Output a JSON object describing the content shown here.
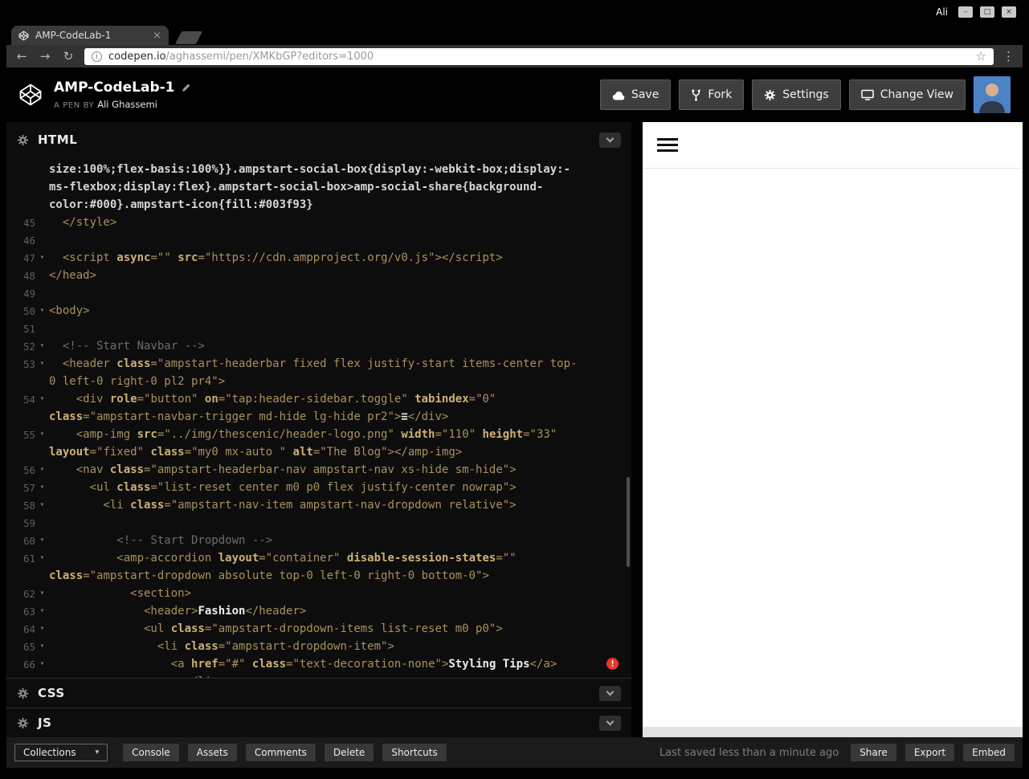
{
  "window": {
    "user": "Ali"
  },
  "icons": {
    "minimize": "–",
    "maximize": "□",
    "close": "×",
    "back": "←",
    "forward": "→",
    "reload": "↻",
    "info": "i",
    "star": "☆",
    "menu_dots": "⋮",
    "dropdown_caret": "▾",
    "fold": "▾",
    "error": "!"
  },
  "browser": {
    "tab_title": "AMP-CodeLab-1",
    "url_domain": "codepen.io",
    "url_path": "/aghassemi/pen/XMKbGP?editors=1000"
  },
  "header": {
    "pen_title": "AMP-CodeLab-1",
    "byline_prefix": "A PEN BY",
    "author": "Ali Ghassemi",
    "buttons": {
      "save": "Save",
      "fork": "Fork",
      "settings": "Settings",
      "change_view": "Change View"
    }
  },
  "editor": {
    "panels": {
      "html": "HTML",
      "css": "CSS",
      "js": "JS"
    },
    "html_rows": [
      {
        "n": "",
        "s": [
          [
            "p",
            "size:100%;flex-basis:100%}}.ampstart-social-box{display:-webkit-box;display:-"
          ]
        ]
      },
      {
        "n": "",
        "s": [
          [
            "p",
            "ms-flexbox;display:flex}.ampstart-social-box>amp-social-share{background-"
          ]
        ]
      },
      {
        "n": "",
        "s": [
          [
            "p",
            "color:#000}.ampstart-icon{fill:#003f93}"
          ]
        ]
      },
      {
        "n": "45",
        "s": [
          [
            "t",
            "  </style>"
          ]
        ]
      },
      {
        "n": "46",
        "s": []
      },
      {
        "n": "47",
        "f": true,
        "s": [
          [
            "t",
            "  <script "
          ],
          [
            "a",
            "async"
          ],
          [
            "t",
            "="
          ],
          [
            "s",
            "\"\""
          ],
          [
            "t",
            " "
          ],
          [
            "a",
            "src"
          ],
          [
            "t",
            "="
          ],
          [
            "s",
            "\"https://cdn.ampproject.org/v0.js\""
          ],
          [
            "t",
            "></script>"
          ]
        ]
      },
      {
        "n": "48",
        "s": [
          [
            "t",
            "</head>"
          ]
        ]
      },
      {
        "n": "49",
        "s": []
      },
      {
        "n": "50",
        "f": true,
        "s": [
          [
            "t",
            "<body>"
          ]
        ]
      },
      {
        "n": "51",
        "s": []
      },
      {
        "n": "52",
        "f": true,
        "s": [
          [
            "c",
            "  <!-- Start Navbar -->"
          ]
        ]
      },
      {
        "n": "53",
        "f": true,
        "s": [
          [
            "t",
            "  <header "
          ],
          [
            "a",
            "class"
          ],
          [
            "t",
            "="
          ],
          [
            "s",
            "\"ampstart-headerbar fixed flex justify-start items-center top-"
          ]
        ]
      },
      {
        "n": "",
        "s": [
          [
            "s",
            "0 left-0 right-0 pl2 pr4\""
          ],
          [
            "t",
            ">"
          ]
        ]
      },
      {
        "n": "54",
        "f": true,
        "s": [
          [
            "t",
            "    <div "
          ],
          [
            "a",
            "role"
          ],
          [
            "t",
            "="
          ],
          [
            "s",
            "\"button\""
          ],
          [
            "t",
            " "
          ],
          [
            "a",
            "on"
          ],
          [
            "t",
            "="
          ],
          [
            "s",
            "\"tap:header-sidebar.toggle\""
          ],
          [
            "t",
            " "
          ],
          [
            "a",
            "tabindex"
          ],
          [
            "t",
            "="
          ],
          [
            "s",
            "\"0\""
          ]
        ]
      },
      {
        "n": "",
        "s": [
          [
            "a",
            "class"
          ],
          [
            "t",
            "="
          ],
          [
            "s",
            "\"ampstart-navbar-trigger md-hide lg-hide pr2\""
          ],
          [
            "t",
            ">"
          ],
          [
            "x",
            "≡"
          ],
          [
            "t",
            "</div>"
          ]
        ]
      },
      {
        "n": "55",
        "f": true,
        "s": [
          [
            "t",
            "    <amp-img "
          ],
          [
            "a",
            "src"
          ],
          [
            "t",
            "="
          ],
          [
            "s",
            "\"../img/thescenic/header-logo.png\""
          ],
          [
            "t",
            " "
          ],
          [
            "a",
            "width"
          ],
          [
            "t",
            "="
          ],
          [
            "s",
            "\"110\""
          ],
          [
            "t",
            " "
          ],
          [
            "a",
            "height"
          ],
          [
            "t",
            "="
          ],
          [
            "s",
            "\"33\""
          ]
        ]
      },
      {
        "n": "",
        "s": [
          [
            "a",
            "layout"
          ],
          [
            "t",
            "="
          ],
          [
            "s",
            "\"fixed\""
          ],
          [
            "t",
            " "
          ],
          [
            "a",
            "class"
          ],
          [
            "t",
            "="
          ],
          [
            "s",
            "\"my0 mx-auto \""
          ],
          [
            "t",
            " "
          ],
          [
            "a",
            "alt"
          ],
          [
            "t",
            "="
          ],
          [
            "s",
            "\"The Blog\""
          ],
          [
            "t",
            "></amp-img>"
          ]
        ]
      },
      {
        "n": "56",
        "f": true,
        "s": [
          [
            "t",
            "    <nav "
          ],
          [
            "a",
            "class"
          ],
          [
            "t",
            "="
          ],
          [
            "s",
            "\"ampstart-headerbar-nav ampstart-nav xs-hide sm-hide\""
          ],
          [
            "t",
            ">"
          ]
        ]
      },
      {
        "n": "57",
        "f": true,
        "s": [
          [
            "t",
            "      <ul "
          ],
          [
            "a",
            "class"
          ],
          [
            "t",
            "="
          ],
          [
            "s",
            "\"list-reset center m0 p0 flex justify-center nowrap\""
          ],
          [
            "t",
            ">"
          ]
        ]
      },
      {
        "n": "58",
        "f": true,
        "s": [
          [
            "t",
            "        <li "
          ],
          [
            "a",
            "class"
          ],
          [
            "t",
            "="
          ],
          [
            "s",
            "\"ampstart-nav-item ampstart-nav-dropdown relative\""
          ],
          [
            "t",
            ">"
          ]
        ]
      },
      {
        "n": "59",
        "s": []
      },
      {
        "n": "60",
        "f": true,
        "s": [
          [
            "c",
            "          <!-- Start Dropdown -->"
          ]
        ]
      },
      {
        "n": "61",
        "f": true,
        "s": [
          [
            "t",
            "          <amp-accordion "
          ],
          [
            "a",
            "layout"
          ],
          [
            "t",
            "="
          ],
          [
            "s",
            "\"container\""
          ],
          [
            "t",
            " "
          ],
          [
            "a",
            "disable-session-states"
          ],
          [
            "t",
            "="
          ],
          [
            "s",
            "\"\""
          ]
        ]
      },
      {
        "n": "",
        "s": [
          [
            "a",
            "class"
          ],
          [
            "t",
            "="
          ],
          [
            "s",
            "\"ampstart-dropdown absolute top-0 left-0 right-0 bottom-0\""
          ],
          [
            "t",
            ">"
          ]
        ]
      },
      {
        "n": "62",
        "f": true,
        "s": [
          [
            "t",
            "            <section>"
          ]
        ]
      },
      {
        "n": "63",
        "f": true,
        "s": [
          [
            "t",
            "              <header>"
          ],
          [
            "x",
            "Fashion"
          ],
          [
            "t",
            "</header>"
          ]
        ]
      },
      {
        "n": "64",
        "f": true,
        "s": [
          [
            "t",
            "              <ul "
          ],
          [
            "a",
            "class"
          ],
          [
            "t",
            "="
          ],
          [
            "s",
            "\"ampstart-dropdown-items list-reset m0 p0\""
          ],
          [
            "t",
            ">"
          ]
        ]
      },
      {
        "n": "65",
        "f": true,
        "s": [
          [
            "t",
            "                <li "
          ],
          [
            "a",
            "class"
          ],
          [
            "t",
            "="
          ],
          [
            "s",
            "\"ampstart-dropdown-item\""
          ],
          [
            "t",
            ">"
          ]
        ]
      },
      {
        "n": "66",
        "f": true,
        "e": true,
        "s": [
          [
            "t",
            "                  <a "
          ],
          [
            "a",
            "href"
          ],
          [
            "t",
            "="
          ],
          [
            "s",
            "\"#\""
          ],
          [
            "t",
            " "
          ],
          [
            "a",
            "class"
          ],
          [
            "t",
            "="
          ],
          [
            "s",
            "\"text-decoration-none\""
          ],
          [
            "t",
            ">"
          ],
          [
            "x",
            "Styling Tips"
          ],
          [
            "t",
            "</a>"
          ]
        ]
      },
      {
        "n": "",
        "s": [
          [
            "t",
            "                    </li>"
          ]
        ]
      }
    ]
  },
  "footer": {
    "collections_label": "Collections",
    "buttons": [
      "Console",
      "Assets",
      "Comments",
      "Delete",
      "Shortcuts"
    ],
    "saved_status": "Last saved less than a minute ago",
    "right_buttons": [
      "Share",
      "Export",
      "Embed"
    ]
  }
}
